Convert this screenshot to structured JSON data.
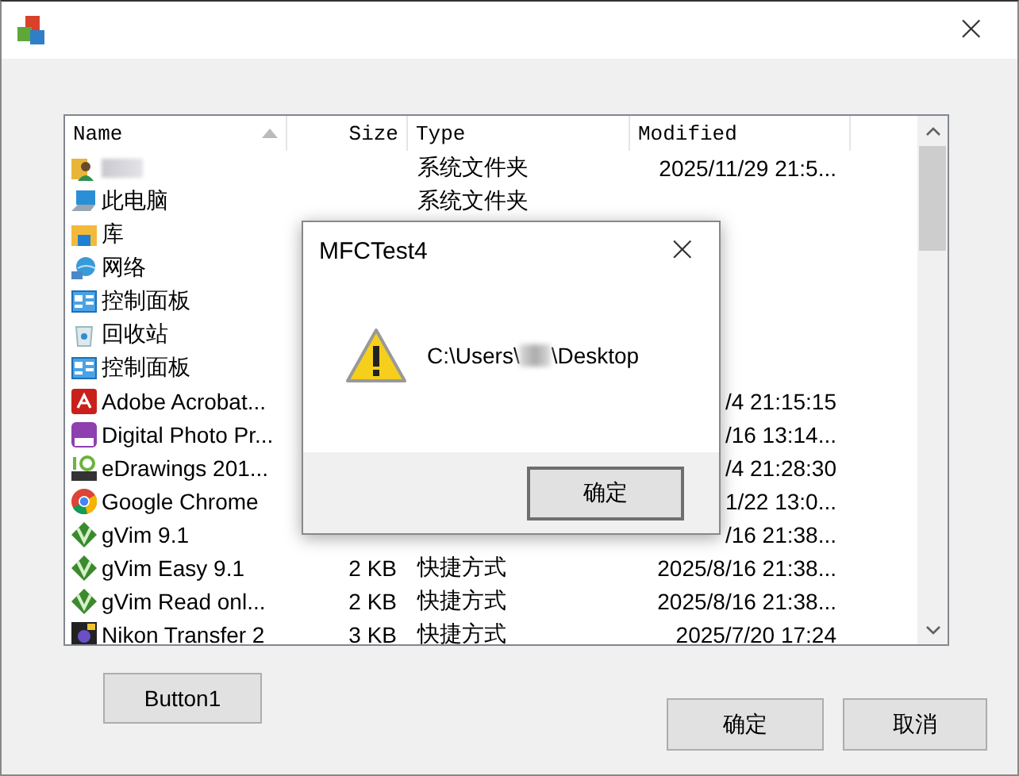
{
  "window": {
    "close": "×"
  },
  "list": {
    "columns": [
      {
        "label": "Name",
        "sorted": true
      },
      {
        "label": "Size",
        "sorted": false
      },
      {
        "label": "Type",
        "sorted": false
      },
      {
        "label": "Modified",
        "sorted": false
      }
    ],
    "rows": [
      {
        "kind": "user",
        "blurred": true,
        "type": "系统文件夹",
        "modified": "2025/11/29 21:5..."
      },
      {
        "kind": "computer",
        "blurred": false,
        "name": "此电脑",
        "type": "系统文件夹"
      },
      {
        "kind": "library",
        "blurred": false,
        "name": "库"
      },
      {
        "kind": "network",
        "blurred": false,
        "name": "网络"
      },
      {
        "kind": "panel",
        "blurred": false,
        "name": "控制面板"
      },
      {
        "kind": "bin",
        "blurred": false,
        "name": "回收站"
      },
      {
        "kind": "panel",
        "blurred": false,
        "name": "控制面板"
      },
      {
        "kind": "pdf",
        "blurred": false,
        "name": "Adobe Acrobat...",
        "modified": "/4 21:15:15"
      },
      {
        "kind": "dpp",
        "blurred": false,
        "name": "Digital Photo Pr...",
        "modified": "/16 13:14..."
      },
      {
        "kind": "edrawings",
        "blurred": false,
        "name": "eDrawings 201...",
        "modified": "/4 21:28:30"
      },
      {
        "kind": "chrome",
        "blurred": false,
        "name": "Google Chrome",
        "modified": "1/22 13:0..."
      },
      {
        "kind": "vim",
        "blurred": false,
        "name": "gVim 9.1",
        "modified": "/16 21:38..."
      },
      {
        "kind": "vim",
        "blurred": false,
        "name": "gVim Easy 9.1",
        "size": "2 KB",
        "type": "快捷方式",
        "modified": "2025/8/16 21:38..."
      },
      {
        "kind": "vim",
        "blurred": false,
        "name": "gVim Read onl...",
        "size": "2 KB",
        "type": "快捷方式",
        "modified": "2025/8/16 21:38..."
      },
      {
        "kind": "nikon",
        "blurred": false,
        "name": "Nikon Transfer 2",
        "size": "3 KB",
        "type": "快捷方式",
        "modified": "2025/7/20 17:24"
      }
    ]
  },
  "buttons": {
    "left": "Button1",
    "ok": "确定",
    "cancel": "取消"
  },
  "dialog": {
    "title": "MFCTest4",
    "message_before": "C:\\Users\\",
    "message_after": "\\Desktop",
    "button": "确定"
  }
}
